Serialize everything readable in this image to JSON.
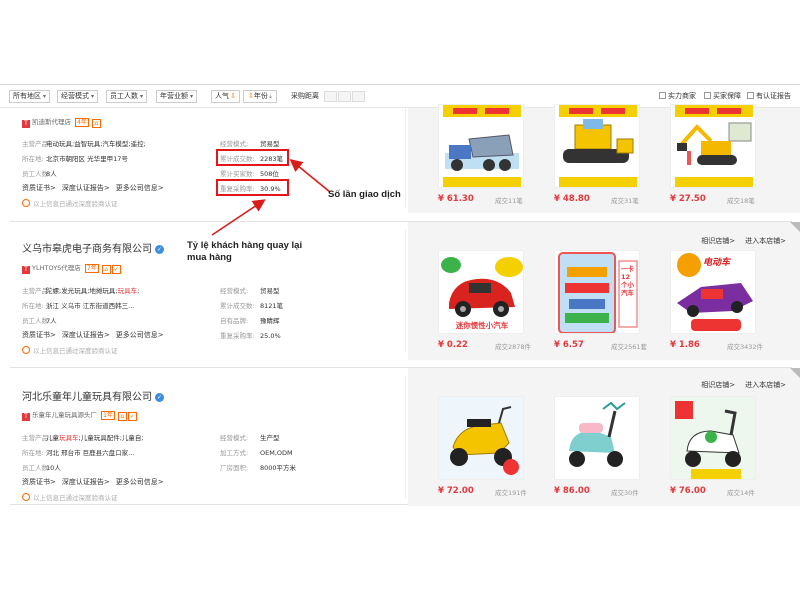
{
  "filters": {
    "region": "所有地区",
    "mode": "经营模式",
    "staff": "员工人数",
    "revenue": "年营业额",
    "sort_popularity": "人气",
    "sort_year": "年份",
    "purchase_distance": "采购距离",
    "check_tiered": "实力商家",
    "check_buyer": "买家保障",
    "check_cert": "有认证报告"
  },
  "annotations": {
    "transactions": "Số lần giao dịch",
    "repurchase": "Tỷ lệ khách hàng quay lại mua hàng"
  },
  "companies": [
    {
      "name": "",
      "shop_badge": "凯迪斯代理店",
      "years": "4年",
      "fields_left": [
        {
          "label": "主营产品:",
          "value": "电动玩具;益智玩具;汽车模型;遥控;"
        },
        {
          "label": "所在地:",
          "value": "北京市朝阳区 光华里甲17号"
        },
        {
          "label": "员工人数:",
          "value": "8人"
        }
      ],
      "fields_right": [
        {
          "label": "经营模式:",
          "value": "贸易型"
        },
        {
          "label": "累计成交数:",
          "value": "2283笔"
        },
        {
          "label": "累计买家数:",
          "value": "508位"
        },
        {
          "label": "重复采购率:",
          "value": "30.9%"
        }
      ],
      "links": [
        "资质证书>",
        "深度认证报告>",
        "更多公司信息>"
      ],
      "cert_note": "以上信息已通过深度验商认证",
      "shop_links": [],
      "products": [
        {
          "price": "¥ 61.30",
          "sold": "成交11笔",
          "icon": "dump-truck-toy"
        },
        {
          "price": "¥ 48.80",
          "sold": "成交31笔",
          "icon": "bulldozer-toy"
        },
        {
          "price": "¥ 27.50",
          "sold": "成交18笔",
          "icon": "excavator-toy"
        }
      ]
    },
    {
      "name": "义乌市皋虎电子商务有限公司",
      "shop_badge": "YLHTOYS代理店",
      "years": "7年",
      "fields_left": [
        {
          "label": "主营产品:",
          "value": "陀螺;发光玩具;地摊玩具;玩具车;"
        },
        {
          "label": "所在地:",
          "value": "浙江 义乌市 江东街道西韩三..."
        },
        {
          "label": "员工人数:",
          "value": "7人"
        }
      ],
      "fields_right": [
        {
          "label": "经营模式:",
          "value": "贸易型"
        },
        {
          "label": "累计成交数:",
          "value": "8121笔"
        },
        {
          "label": "自有品牌:",
          "value": "豫睛辉"
        },
        {
          "label": "重复采购率:",
          "value": "25.0%"
        }
      ],
      "links": [
        "资质证书>",
        "深度认证报告>",
        "更多公司信息>"
      ],
      "cert_note": "以上信息已通过深度验商认证",
      "shop_links": [
        "相识店铺>",
        "进入本店铺>"
      ],
      "products": [
        {
          "price": "¥ 0.22",
          "sold": "成交2878件",
          "icon": "mini-car-toy",
          "caption": "迷你惯性小汽车"
        },
        {
          "price": "¥ 6.57",
          "sold": "成交2561套",
          "icon": "car-set-toy"
        },
        {
          "price": "¥ 1.86",
          "sold": "成交3432件",
          "icon": "racing-car-toy",
          "caption": "电动车"
        }
      ]
    },
    {
      "name": "河北乐童年儿童玩具有限公司",
      "shop_badge": "乐童年儿童玩具源头厂",
      "years": "1年",
      "fields_left": [
        {
          "label": "主营产品:",
          "value": "儿童玩具车;儿童玩具配件;儿童自;"
        },
        {
          "label": "所在地:",
          "value": "河北 邢台市 巨鹿县六盘口家..."
        },
        {
          "label": "员工人数:",
          "value": "10人"
        }
      ],
      "fields_right": [
        {
          "label": "经营模式:",
          "value": "生产型"
        },
        {
          "label": "加工方式:",
          "value": "OEM,ODM"
        },
        {
          "label": "厂房面积:",
          "value": "8000平方米"
        }
      ],
      "links": [
        "资质证书>",
        "深度认证报告>",
        "更多公司信息>"
      ],
      "cert_note": "以上信息已通过深度验商认证",
      "shop_links": [
        "相识店铺>",
        "进入本店铺>"
      ],
      "products": [
        {
          "price": "¥ 72.00",
          "sold": "成交191件",
          "icon": "kids-motorbike"
        },
        {
          "price": "¥ 86.00",
          "sold": "成交30件",
          "icon": "kids-scooter"
        },
        {
          "price": "¥ 76.00",
          "sold": "成交14件",
          "icon": "kids-ride-on"
        }
      ]
    }
  ]
}
